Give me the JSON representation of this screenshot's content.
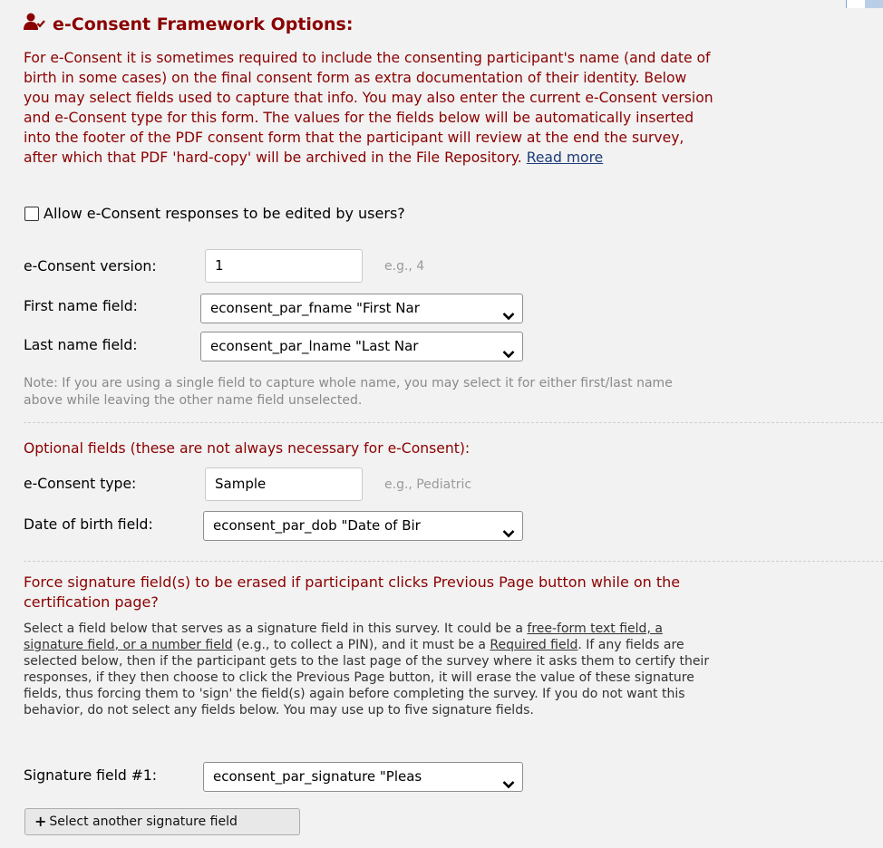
{
  "section": {
    "title": "e-Consent Framework Options:",
    "intro_lines": [
      "For e-Consent it is sometimes required to include the consenting participant's name (and date of",
      "birth in some cases) on the final consent form as extra documentation of their identity. Below",
      "you may select fields used to capture that info. You may also enter the current e-Consent version",
      "and e-Consent type for this form. The values for the fields below will be automatically inserted",
      "into the footer of the PDF consent form that the participant will review at the end the survey,",
      "after which that PDF 'hard-copy' will be archived in the File Repository."
    ],
    "read_more": "Read more"
  },
  "allow_edit": {
    "label": "Allow e-Consent responses to be edited by users?",
    "checked": false
  },
  "version": {
    "label": "e-Consent version:",
    "value": "1",
    "example": "e.g., 4"
  },
  "first_name": {
    "label": "First name field:",
    "value": "econsent_par_fname \"First Nar"
  },
  "last_name": {
    "label": "Last name field:",
    "value": "econsent_par_lname \"Last Nar"
  },
  "name_note": {
    "lines": [
      "Note: If you are using a single field to capture whole name, you may select it for either first/last name",
      "above while leaving the other name field unselected."
    ]
  },
  "optional": {
    "title": "Optional fields (these are not always necessary for e-Consent):",
    "type_label": "e-Consent type:",
    "type_value": "Sample",
    "type_example": "e.g., Pediatric",
    "dob_label": "Date of birth field:",
    "dob_value": "econsent_par_dob \"Date of Bir"
  },
  "force": {
    "title_lines": [
      "Force signature field(s) to be erased if participant clicks Previous Page button while on the",
      "certification page?"
    ],
    "desc_line1_a": "Select a field below that serves as a signature field in this survey. It could be a ",
    "desc_line1_link": "free-form text field, a",
    "desc_line2_link": "signature field, or a number field",
    "desc_line2_b": " (e.g., to collect a PIN), and it must be a ",
    "desc_line2_req": "Required field",
    "desc_line2_c": ". If any fields are",
    "desc_rest": [
      "selected below, then if the participant gets to the last page of the survey where it asks them to certify their",
      "responses, if they then choose to click the Previous Page button, it will erase the value of these signature",
      "fields, thus forcing them to 'sign' the field(s) again before completing the survey. If you do not want this",
      "behavior, do not select any fields below. You may use up to five signature fields."
    ],
    "sig_label": "Signature field #1:",
    "sig_value": "econsent_par_signature \"Pleas",
    "add_button": "Select another signature field"
  },
  "colors": {
    "title": "#8b0000",
    "link": "#1d3c78",
    "note": "#8a8a8a",
    "background": "#f2f2f2"
  },
  "icons": {
    "title_icon": "user-check-icon",
    "dropdown_icon": "chevron-down-icon",
    "add_icon": "plus-icon"
  }
}
